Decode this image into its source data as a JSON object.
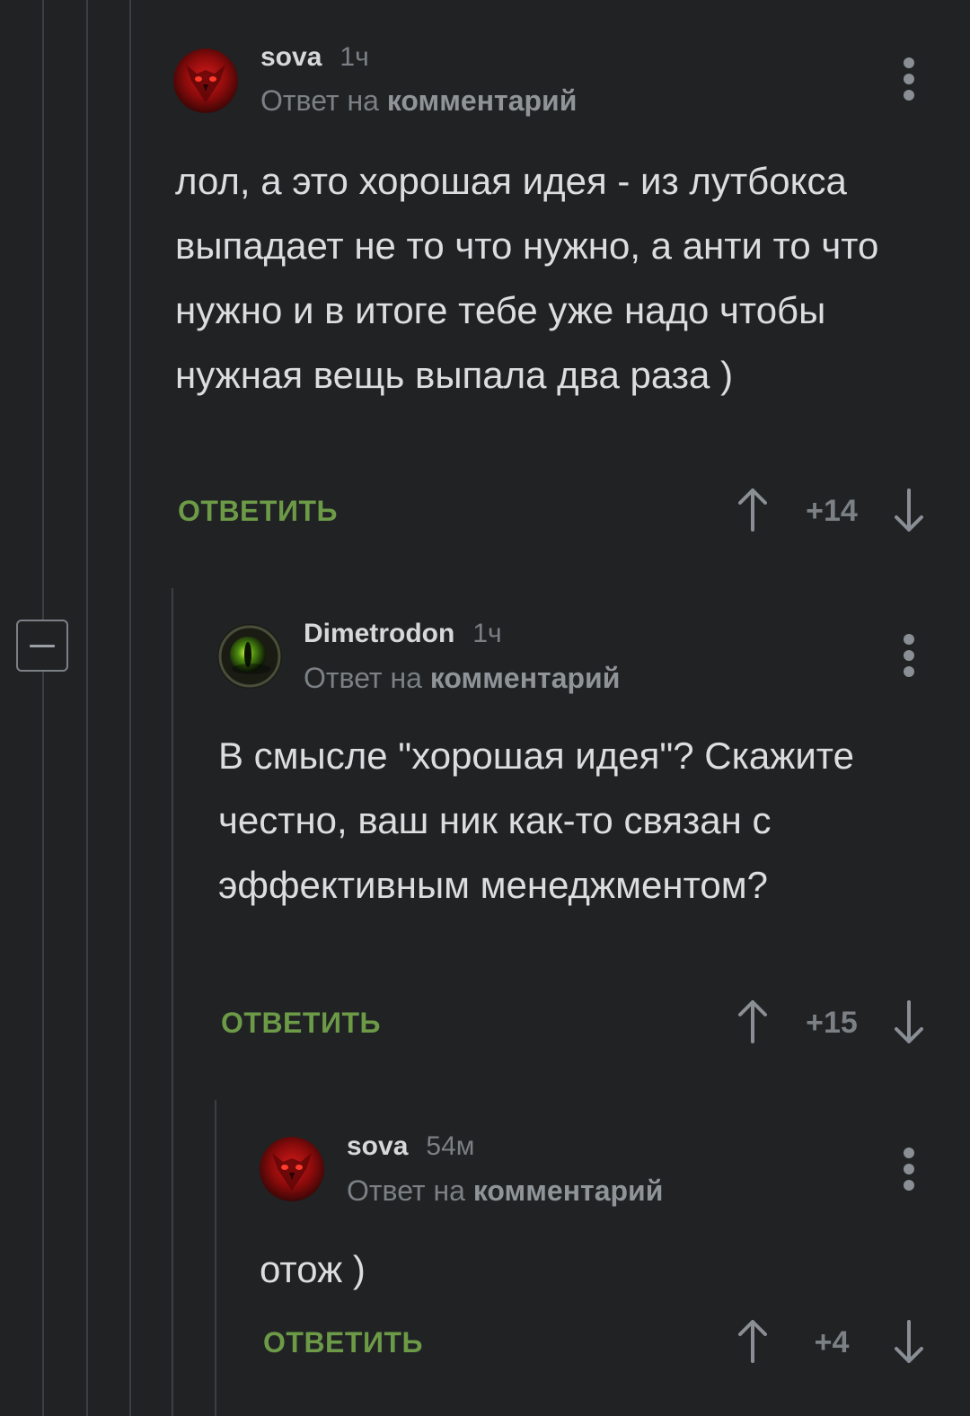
{
  "theme": {
    "background": "#202224",
    "thread_line": "#3c3f42",
    "accent_green": "#6c9a47",
    "muted_text": "#7b8085"
  },
  "comments": [
    {
      "author": "sova",
      "time": "1ч",
      "reply_prefix": "Ответ на",
      "reply_target": "комментарий",
      "text": "лол, а это хорошая идея - из лутбокса выпадает не то что нужно, а анти то что нужно и в итоге тебе уже надо чтобы нужная вещь выпала два раза )",
      "reply_label": "ОТВЕТИТЬ",
      "score": "+14",
      "avatar_icon": "red-owl-avatar"
    },
    {
      "author": "Dimetrodon",
      "time": "1ч",
      "reply_prefix": "Ответ на",
      "reply_target": "комментарий",
      "text": "В смысле \"хорошая идея\"? Скажите честно, ваш ник как-то связан с эффективным менеджментом?",
      "reply_label": "ОТВЕТИТЬ",
      "score": "+15",
      "avatar_icon": "green-eye-avatar"
    },
    {
      "author": "sova",
      "time": "54м",
      "reply_prefix": "Ответ на",
      "reply_target": "комментарий",
      "text": "отож )",
      "reply_label": "ОТВЕТИТЬ",
      "score": "+4",
      "avatar_icon": "red-owl-avatar"
    }
  ],
  "icons": {
    "collapse": "minus-square-icon",
    "more": "vertical-dots-icon",
    "upvote": "arrow-up-icon",
    "downvote": "arrow-down-icon"
  }
}
